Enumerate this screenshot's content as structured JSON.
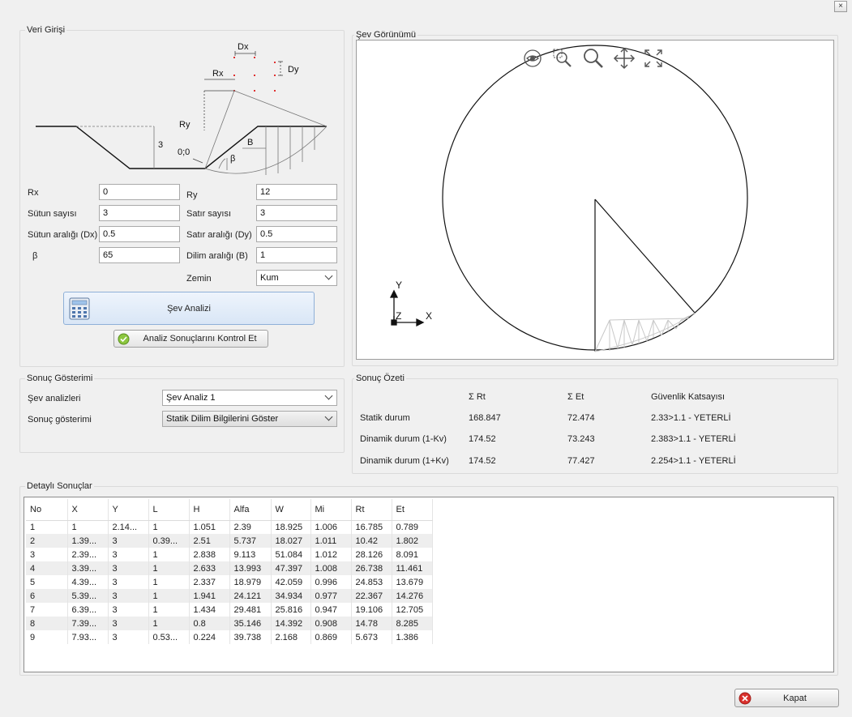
{
  "window": {
    "close_label": "×"
  },
  "input_group": {
    "title": "Veri Girişi",
    "schema_labels": {
      "dx": "Dx",
      "dy": "Dy",
      "rx": "Rx",
      "ry": "Ry",
      "three": "3",
      "origin": "0;0",
      "beta": "β",
      "b": "B"
    },
    "fields": {
      "rx": {
        "label": "Rx",
        "value": "0"
      },
      "ry": {
        "label": "Ry",
        "value": "12"
      },
      "sutun_sayisi": {
        "label": "Sütun sayısı",
        "value": "3"
      },
      "satir_sayisi": {
        "label": "Satır sayısı",
        "value": "3"
      },
      "sutun_araligi": {
        "label": "Sütun aralığı (Dx)",
        "value": "0.5"
      },
      "satir_araligi": {
        "label": "Satır aralığı (Dy)",
        "value": "0.5"
      },
      "beta": {
        "label": "β",
        "value": "65"
      },
      "dilim_araligi": {
        "label": "Dilim aralığı (B)",
        "value": "1"
      },
      "zemin": {
        "label": "Zemin",
        "value": "Kum"
      }
    },
    "analyze_button": "Şev Analizi",
    "check_button": "Analiz Sonuçlarını Kontrol Et"
  },
  "view_group": {
    "title": "Şev Görünümü",
    "toolbar": [
      "eye-icon",
      "zoom-window-icon",
      "zoom-icon",
      "pan-icon",
      "fit-extents-icon"
    ],
    "axes": {
      "y": "Y",
      "z": "Z",
      "x": "X"
    }
  },
  "result_display": {
    "title": "Sonuç Gösterimi",
    "analyses_label": "Şev analizleri",
    "analyses_value": "Şev Analiz 1",
    "display_label": "Sonuç gösterimi",
    "display_value": "Statik Dilim Bilgilerini Göster"
  },
  "summary": {
    "title": "Sonuç Özeti",
    "headers": [
      "",
      "Σ Rt",
      "Σ Et",
      "Güvenlik Katsayısı"
    ],
    "rows": [
      [
        "Statik durum",
        "168.847",
        "72.474",
        "2.33>1.1 - YETERLİ"
      ],
      [
        "Dinamik durum (1-Kv)",
        "174.52",
        "73.243",
        "2.383>1.1 - YETERLİ"
      ],
      [
        "Dinamik durum (1+Kv)",
        "174.52",
        "77.427",
        "2.254>1.1 - YETERLİ"
      ]
    ]
  },
  "details": {
    "title": "Detaylı Sonuçlar",
    "columns": [
      "No",
      "X",
      "Y",
      "L",
      "H",
      "Alfa",
      "W",
      "Mi",
      "Rt",
      "Et"
    ],
    "rows": [
      [
        "1",
        "1",
        "2.14...",
        "1",
        "1.051",
        "2.39",
        "18.925",
        "1.006",
        "16.785",
        "0.789"
      ],
      [
        "2",
        "1.39...",
        "3",
        "0.39...",
        "2.51",
        "5.737",
        "18.027",
        "1.011",
        "10.42",
        "1.802"
      ],
      [
        "3",
        "2.39...",
        "3",
        "1",
        "2.838",
        "9.113",
        "51.084",
        "1.012",
        "28.126",
        "8.091"
      ],
      [
        "4",
        "3.39...",
        "3",
        "1",
        "2.633",
        "13.993",
        "47.397",
        "1.008",
        "26.738",
        "11.461"
      ],
      [
        "5",
        "4.39...",
        "3",
        "1",
        "2.337",
        "18.979",
        "42.059",
        "0.996",
        "24.853",
        "13.679"
      ],
      [
        "6",
        "5.39...",
        "3",
        "1",
        "1.941",
        "24.121",
        "34.934",
        "0.977",
        "22.367",
        "14.276"
      ],
      [
        "7",
        "6.39...",
        "3",
        "1",
        "1.434",
        "29.481",
        "25.816",
        "0.947",
        "19.106",
        "12.705"
      ],
      [
        "8",
        "7.39...",
        "3",
        "1",
        "0.8",
        "35.146",
        "14.392",
        "0.908",
        "14.78",
        "8.285"
      ],
      [
        "9",
        "7.93...",
        "3",
        "0.53...",
        "0.224",
        "39.738",
        "2.168",
        "0.869",
        "5.673",
        "1.386"
      ]
    ]
  },
  "footer": {
    "close_button": "Kapat"
  }
}
